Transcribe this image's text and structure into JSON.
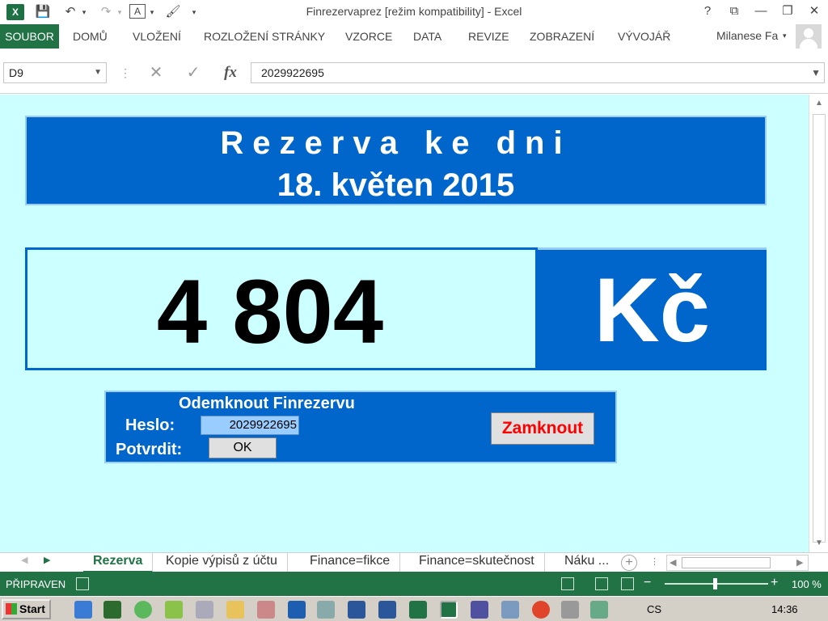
{
  "app": {
    "logo_text": "X",
    "title": "Finrezervaprez  [režim kompatibility] - Excel",
    "window_controls": [
      "?",
      "⧉",
      "—",
      "❐",
      "✕"
    ]
  },
  "quick_access": {
    "save": "💾",
    "undo": "↶",
    "redo": "↷"
  },
  "ribbon": {
    "tabs": [
      "SOUBOR",
      "DOMŮ",
      "VLOŽENÍ",
      "ROZLOŽENÍ STRÁNKY",
      "VZORCE",
      "DATA",
      "REVIZE",
      "ZOBRAZENÍ",
      "VÝVOJÁŘ"
    ],
    "account": "Milanese Fa"
  },
  "formula_bar": {
    "name_box": "D9",
    "cancel": "✕",
    "enter": "✓",
    "fx": "fx",
    "formula": "2029922695"
  },
  "sheet": {
    "banner_line1": "Rezerva ke dni",
    "banner_line2": "18. květen 2015",
    "amount": "4 804",
    "currency": "Kč",
    "panel_title": "Odemknout Finrezervu",
    "password_label": "Heslo:",
    "password_value": "2029922695",
    "confirm_label": "Potvrdit:",
    "ok_button": "OK",
    "lock_button": "Zamknout"
  },
  "sheet_tabs": [
    "Rezerva",
    "Kopie výpisů z účtu",
    "Finance=fikce",
    "Finance=skutečnost",
    "Náku ..."
  ],
  "status": {
    "ready": "PŘIPRAVEN",
    "zoom": "100 %"
  },
  "taskbar": {
    "start": "Start",
    "language": "CS",
    "time": "14:36"
  },
  "colors": {
    "sheet_bg": "#ccffff",
    "panel_blue": "#0066cc",
    "excel_green": "#217346",
    "lock_red": "#ff0000"
  }
}
